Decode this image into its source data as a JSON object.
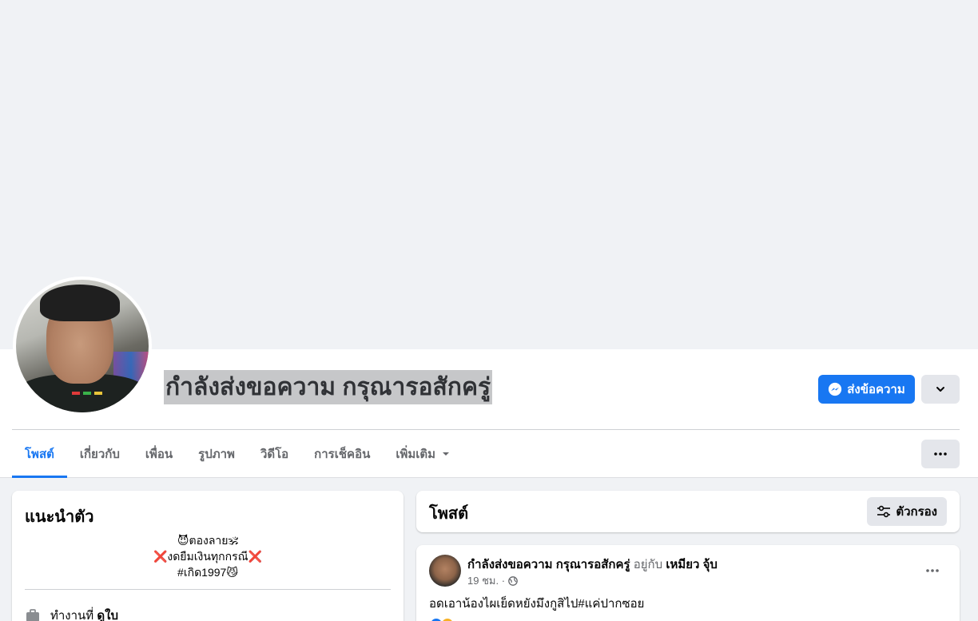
{
  "profile": {
    "name": "กำลังส่งขอความ กรุณารอสักครู่"
  },
  "actions": {
    "message_label": "ส่งข้อความ"
  },
  "tabs": [
    {
      "label": "โพสต์",
      "active": true
    },
    {
      "label": "เกี่ยวกับ",
      "active": false
    },
    {
      "label": "เพื่อน",
      "active": false
    },
    {
      "label": "รูปภาพ",
      "active": false
    },
    {
      "label": "วิดีโอ",
      "active": false
    },
    {
      "label": "การเช็คอิน",
      "active": false
    },
    {
      "label": "เพิ่มเติม",
      "active": false
    }
  ],
  "intro": {
    "title": "แนะนำตัว",
    "bio": [
      "😈ตองลาย🕉",
      "❌งดยืมเงินทุกกรณี❌",
      "#เกิด1997😼"
    ],
    "work_prefix": "ทำงานที่",
    "work_place": "ดูใบ"
  },
  "posts_section": {
    "title": "โพสต์",
    "filter_label": "ตัวกรอง"
  },
  "post": {
    "author": "กำลังส่งขอความ กรุณารอสักครู่",
    "with_text": "อยู่กับ",
    "with_person": "เหมียว จุ้บ",
    "time": "19 ชม. ·",
    "text": "อดเอาน้องไผเย็ดหยังมึงกูสิไป#แค่ปากซอย"
  },
  "colors": {
    "accent": "#1877f2",
    "background": "#f0f2f5",
    "name_highlight": "#c6c7c9"
  }
}
